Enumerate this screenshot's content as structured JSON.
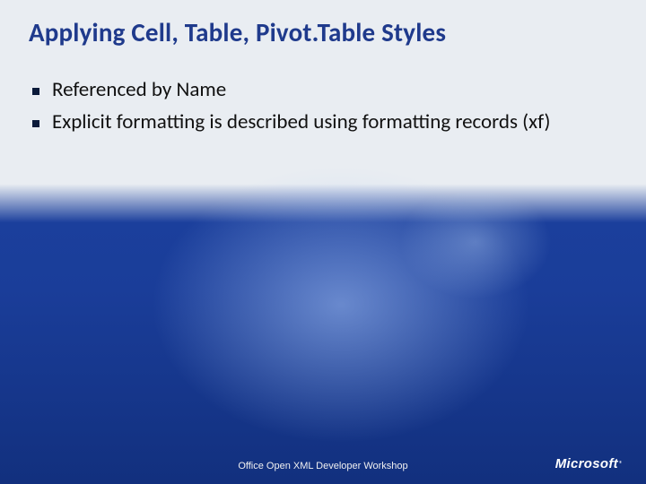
{
  "slide": {
    "title": "Applying Cell, Table, Pivot.Table Styles",
    "bullets": [
      "Referenced by Name",
      "Explicit formatting is described using formatting records (xf)"
    ],
    "footer": "Office Open XML Developer Workshop",
    "logo": {
      "brand": "Microsoft",
      "registered": "®"
    }
  }
}
